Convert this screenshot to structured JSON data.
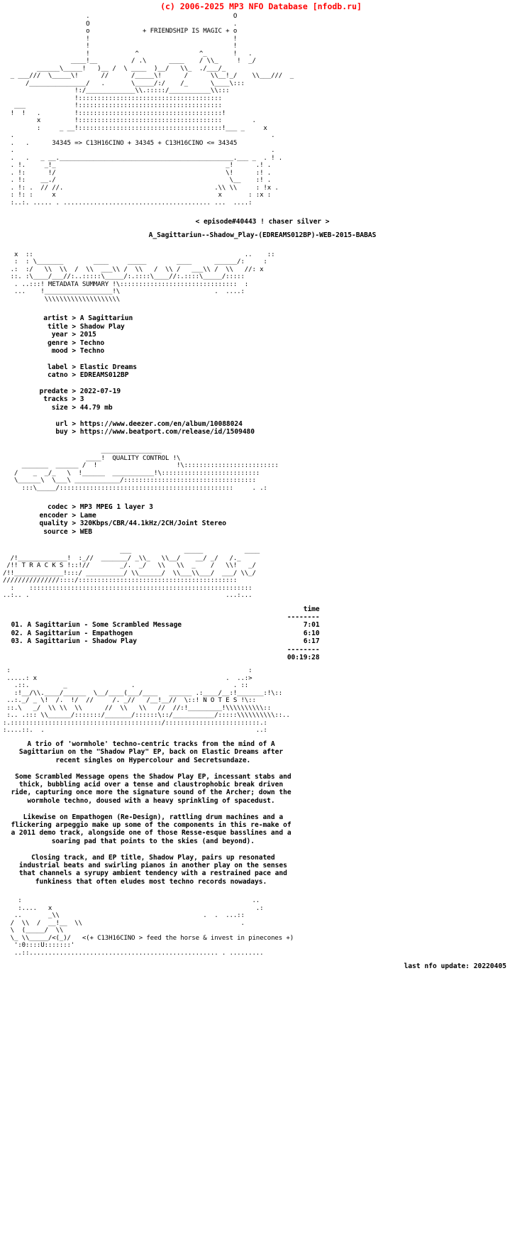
{
  "topbar": {
    "copyright": "(c) 2006-2025 MP3 NFO Database [nfodb.ru]",
    "color": "#ff0000"
  },
  "header": {
    "tagline": "+ FRIENDSHIP IS MAGIC +",
    "formula_line": "34345 => C13H16CINO + 34345 + C13H16CINO <= 34345",
    "episode_line": "< episode#40443 ! chaser silver >",
    "release_name": "A_Sagittariun--Shadow_Play-(EDREAMS012BP)-WEB-2015-BABAS"
  },
  "sections": {
    "metadata_title": "METADATA SUMMARY",
    "quality_title": "QUALITY CONTROL",
    "tracks_title": "T R A C K S",
    "notes_title": "N O T E S"
  },
  "metadata": {
    "group_a": [
      {
        "label": "artist",
        "value": "A Sagittariun"
      },
      {
        "label": "title",
        "value": "Shadow Play"
      },
      {
        "label": "year",
        "value": "2015"
      },
      {
        "label": "genre",
        "value": "Techno"
      },
      {
        "label": "mood",
        "value": "Techno"
      }
    ],
    "group_b": [
      {
        "label": "label",
        "value": "Elastic Dreams"
      },
      {
        "label": "catno",
        "value": "EDREAMS012BP"
      }
    ],
    "group_c": [
      {
        "label": "predate",
        "value": "2022-07-19"
      },
      {
        "label": "tracks",
        "value": "3"
      },
      {
        "label": "size",
        "value": "44.79 mb"
      }
    ],
    "group_d": [
      {
        "label": "url",
        "value": "https://www.deezer.com/en/album/10088024"
      },
      {
        "label": "buy",
        "value": "https://www.beatport.com/release/id/1509480"
      }
    ]
  },
  "quality": [
    {
      "label": "codec",
      "value": "MP3 MPEG 1 layer 3"
    },
    {
      "label": "encoder",
      "value": "Lame"
    },
    {
      "label": "quality",
      "value": "320Kbps/CBR/44.1kHz/2CH/Joint Stereo"
    },
    {
      "label": "source",
      "value": "WEB"
    }
  ],
  "tracklist": {
    "time_header": "time",
    "divider": "--------",
    "rows": [
      {
        "num": "01.",
        "artist": "A Sagittariun",
        "title": "Some Scrambled Message",
        "time": "7:01"
      },
      {
        "num": "02.",
        "artist": "A Sagittariun",
        "title": "Empathogen",
        "time": "6:10"
      },
      {
        "num": "03.",
        "artist": "A Sagittariun",
        "title": "Shadow Play",
        "time": "6:17"
      }
    ],
    "total": "00:19:28"
  },
  "notes": {
    "paragraphs": [
      "A trio of 'wormhole' techno-centric tracks from the mind of A\nSagittariun on the \"Shadow Play\" EP, back on Elastic Dreams after\nrecent singles on Hypercolour and Secretsundaze.",
      "Some Scrambled Message opens the Shadow Play EP, incessant stabs and\nthick, bubbling acid over a tense and claustrophobic break driven\nride, capturing once more the signature sound of the Archer; down the\nwormhole techno, doused with a heavy sprinkling of spacedust.",
      "Likewise on Empathogen (Re-Design), rattling drum machines and a\nflickering arpeggio make up some of the components in this re-make of\na 2011 demo track, alongside one of those Resse-esque basslines and a\nsoaring pad that points to the skies (and beyond).",
      "Closing track, and EP title, Shadow Play, pairs up resonated\nindustrial beats and swirling pianos in another play on the senses\nthat channels a syrupy ambient tendency with a restrained pace and\nfunkiness that often eludes most techno records nowadays."
    ]
  },
  "footer": {
    "greet_line": "<(+ C13H16CINO > feed the horse & invest in pinecones +)",
    "last_update": "last nfo update: 20220405"
  },
  "ascii": {
    "header_art": "                      .                                      O\n                      O                                      .\n                      o              + FRIENDSHIP IS MAGIC + o\n                      !                                      !\n                      !                                      !\n                      !            ^                ^_       !   .\n                  ____!__         / .\\      ____    / \\\\_     !  _/\n         ______\\_____!   )__ /  \\ ____  )__/   \\\\_  ./___/_\n  _ ___///  \\_____\\!      //      /_____\\!      /      \\\\__!_/    \\\\___///  _\n      /_______________/   .       \\_____/:/    /_      \\____\\:::\n                   !:/_____________\\\\.:::::/___________\\\\:::\n                   !::::::::::::::::::::::::::::::::::::::\n   ___             !::::::::::::::::::::::::::::::::::::::\n  !  !   .         !::::::::::::::::::::::::::::::::::::::!\n         x         !::::::::::::::::::::::::::::::::::::::        .\n         :     _ __!::::::::::::::::::::::::::::::::::::::!___ _     x",
    "formula_art_top": "  .                                                                    .\n  .   .      34345 => C13H16CINO + 34345 + C13H16CINO <= 34345\n  .                                                                    .\n  .   .   _ __.______________________________________________.___ _  . ! .\n  . !.     _!_                                             _!      .! .\n  . !:      !/                                             \\!      :! .\n  . !:    __./                                              \\__    :! .\n  . !: .  // //.                                        .\\\\ \\\\     : !x .\n  : !: :     x                                           x       : :x :\n  :..:. ..... . ....................................... ...  ....:",
    "metadata_art": "   x  ::                                                        ..    ::\n   :  : \\_______        ____     _____        ____      ______/:     :\n  .:  :/   \\\\  \\\\  /  \\\\  ___\\\\ /  \\\\   /  \\\\ /   ___\\\\ /  \\\\   //: x\n  ::. :\\____/___//:..:::::\\_____/:.::::\\____//:.::::\\_____/:::::\n   . ..:::! METADATA SUMMARY !\\:::::::::::::::::::::::::::::::  :\n   ...    !__________________!\\                         .  ....:\n           \\\\\\\\\\\\\\\\\\\\\\\\\\\\\\\\\\\\\\\\",
    "quality_art": "                          ________________\n                      ____!  QUALITY CONTROL !\\\n     _______  ______ /  !                     !\\:::::::::::::::::::::::::\n   /    _  _/_   \\  !______  ___________!\\::::::::::::::::::::::::::\n   \\______\\  \\___\\ ____________/:::::::::::::::::::::::::::::::::::\n     :::\\_____/::::::::::::::::::::::::::::::::::::::::::::::     . .:",
    "tracks_art": "                               ___              _____           ____\n  /!_____________!  :_//  _______/ _\\\\_   \\\\__/    __/ _/   /._\n /!! T R A C K S !::!//        _/.  _/   \\\\   \\\\  _    /   \\\\!   _/\n/!!_____________!:::/ __________/ \\\\______/  \\\\___\\\\___/  ___/ \\\\_/\n///////////////::::/::::::::::::::::::::::::::::::::::::::::::\n  :    :::::::::::::::::::::::::::::::::::::::::::::::::::::::::::\n..:.. .                                                    ...:...",
    "notes_art": " :                                                               :\n .....: x                                                  .  ..:>\n   .::.         _                 .                          . ::\n   :!__/\\\\.____/______  \\__/____(___/____   ______ .:____/__:!_______:!\\::\n ..:._/ _ \\!  /.  !/  //     /. _//   /__!__//  \\::! N O T E S !\\::\n ::.\\   _/  \\\\ \\\\  \\\\      //  \\\\   \\\\   //  //:!_________!\\\\\\\\\\\\\\\\\\\\::\n :.. .::: \\\\______/:::::::/_______/::::::\\::/___________/:::::\\\\\\\\\\\\\\\\\\\\::..\n:.::::::::::::::::::::::::::::::::::::::::/:::::::::::::::::::::::::.:\n:....::.  .                                                        ..:",
    "footer_art": "    :                                                             ..\n    :....   x                                                      .:\n   ..       _\\\\                                      .  .  ...::\n  /  \\\\  /  __!__  \\\\                                          .\n  \\  (_____/  \\\\\n  \\_ \\\\_____/<(_)/\n   ':0::::U:::::::'\n   ..::.................................................. . ........."
  }
}
